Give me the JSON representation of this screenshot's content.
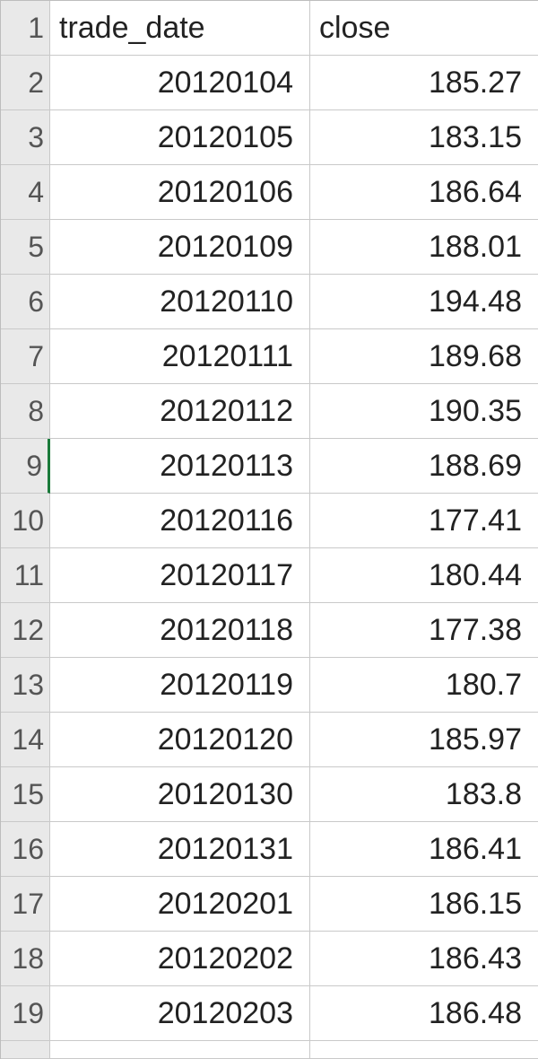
{
  "selected_row": 9,
  "headers": {
    "col1": "trade_date",
    "col2": "close"
  },
  "rows": [
    {
      "rn": "1",
      "c1": "trade_date",
      "c2": "close",
      "is_header": true
    },
    {
      "rn": "2",
      "c1": "20120104",
      "c2": "185.27"
    },
    {
      "rn": "3",
      "c1": "20120105",
      "c2": "183.15"
    },
    {
      "rn": "4",
      "c1": "20120106",
      "c2": "186.64"
    },
    {
      "rn": "5",
      "c1": "20120109",
      "c2": "188.01"
    },
    {
      "rn": "6",
      "c1": "20120110",
      "c2": "194.48"
    },
    {
      "rn": "7",
      "c1": "20120111",
      "c2": "189.68"
    },
    {
      "rn": "8",
      "c1": "20120112",
      "c2": "190.35"
    },
    {
      "rn": "9",
      "c1": "20120113",
      "c2": "188.69"
    },
    {
      "rn": "10",
      "c1": "20120116",
      "c2": "177.41"
    },
    {
      "rn": "11",
      "c1": "20120117",
      "c2": "180.44"
    },
    {
      "rn": "12",
      "c1": "20120118",
      "c2": "177.38"
    },
    {
      "rn": "13",
      "c1": "20120119",
      "c2": "180.7"
    },
    {
      "rn": "14",
      "c1": "20120120",
      "c2": "185.97"
    },
    {
      "rn": "15",
      "c1": "20120130",
      "c2": "183.8"
    },
    {
      "rn": "16",
      "c1": "20120131",
      "c2": "186.41"
    },
    {
      "rn": "17",
      "c1": "20120201",
      "c2": "186.15"
    },
    {
      "rn": "18",
      "c1": "20120202",
      "c2": "186.43"
    },
    {
      "rn": "19",
      "c1": "20120203",
      "c2": "186.48"
    }
  ],
  "chart_data": {
    "type": "table",
    "title": "",
    "columns": [
      "trade_date",
      "close"
    ],
    "data": [
      [
        "20120104",
        185.27
      ],
      [
        "20120105",
        183.15
      ],
      [
        "20120106",
        186.64
      ],
      [
        "20120109",
        188.01
      ],
      [
        "20120110",
        194.48
      ],
      [
        "20120111",
        189.68
      ],
      [
        "20120112",
        190.35
      ],
      [
        "20120113",
        188.69
      ],
      [
        "20120116",
        177.41
      ],
      [
        "20120117",
        180.44
      ],
      [
        "20120118",
        177.38
      ],
      [
        "20120119",
        180.7
      ],
      [
        "20120120",
        185.97
      ],
      [
        "20120130",
        183.8
      ],
      [
        "20120131",
        186.41
      ],
      [
        "20120201",
        186.15
      ],
      [
        "20120202",
        186.43
      ],
      [
        "20120203",
        186.48
      ]
    ]
  }
}
